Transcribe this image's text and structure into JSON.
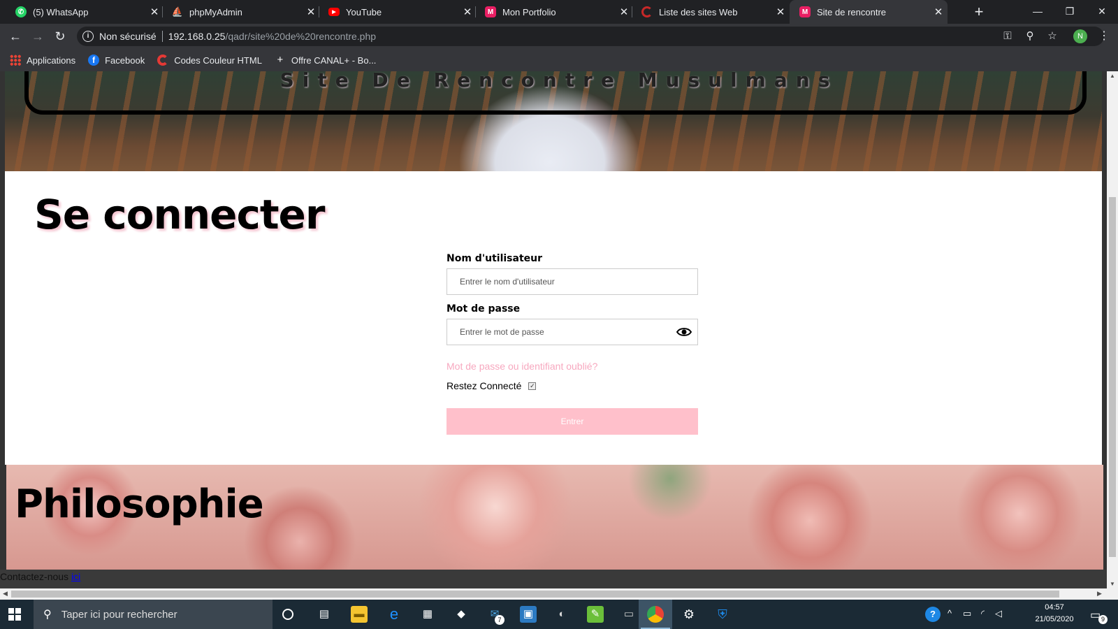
{
  "tabs": [
    {
      "label": "(5) WhatsApp",
      "icon": "whatsapp-icon",
      "color": "#25d366"
    },
    {
      "label": "phpMyAdmin",
      "icon": "phpmyadmin-icon",
      "color": "#f29111"
    },
    {
      "label": "YouTube",
      "icon": "youtube-icon",
      "color": "#ff0000"
    },
    {
      "label": "Mon Portfolio",
      "icon": "portfolio-icon",
      "color": "#e91e63"
    },
    {
      "label": "Liste des sites Web",
      "icon": "site-list-icon",
      "color": "#c62828"
    },
    {
      "label": "Site de rencontre",
      "icon": "site-rencontre-icon",
      "color": "#e91e63"
    }
  ],
  "toolbar": {
    "security": "Non sécurisé",
    "url_host": "192.168.0.25",
    "url_path": "/qadr/site%20de%20rencontre.php",
    "profile_initial": "N"
  },
  "bookmarks": [
    {
      "label": "Applications",
      "icon": "apps-grid-icon"
    },
    {
      "label": "Facebook",
      "icon": "facebook-icon"
    },
    {
      "label": "Codes Couleur HTML",
      "icon": "codes-couleur-icon"
    },
    {
      "label": "Offre CANAL+ - Bo...",
      "icon": "canal-plus-icon"
    }
  ],
  "page": {
    "site_title": "Site De Rencontre Musulmans",
    "login_heading": "Se connecter",
    "username_label": "Nom d'utilisateur",
    "username_placeholder": "Entrer le nom d'utilisateur",
    "password_label": "Mot de passe",
    "password_placeholder": "Entrer le mot de passe",
    "forgot_link": "Mot de passe ou identifiant oublié?",
    "remember_label": "Restez Connecté",
    "remember_checked": true,
    "submit_label": "Entrer",
    "philosophy_heading": "Philosophie",
    "contact_text": "Contactez-nous",
    "contact_link": "ici",
    "accent_color": "#ffc0cb",
    "link_color": "#f7a8bf"
  },
  "taskbar": {
    "search_placeholder": "Taper ici pour rechercher",
    "mail_badge": "7",
    "time": "04:57",
    "date": "21/05/2020",
    "notifications": "9"
  }
}
